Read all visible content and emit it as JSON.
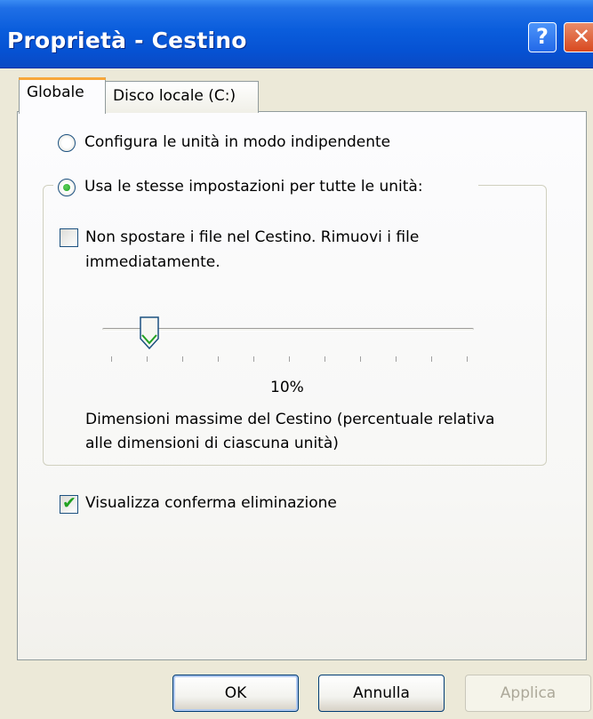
{
  "window": {
    "title": "Proprietà - Cestino",
    "help_label": "?",
    "close_label": "✕"
  },
  "tabs": [
    {
      "label": "Globale",
      "active": true
    },
    {
      "label": "Disco locale (C:)",
      "active": false
    }
  ],
  "options": {
    "radio_independent": {
      "label": "Configura le unità in modo indipendente",
      "checked": false
    },
    "radio_same": {
      "label": "Usa le stesse impostazioni per tutte le unità:",
      "checked": true
    },
    "no_recycle": {
      "line1": "Non spostare i file nel Cestino. Rimuovi i file",
      "line2": "immediatamente.",
      "checked": false
    },
    "slider": {
      "value_label": "10%",
      "value_percent": 10,
      "tick_count": 11
    },
    "size_desc": {
      "line1": "Dimensioni massime del Cestino (percentuale relativa",
      "line2": "alle dimensioni di ciascuna unità)"
    },
    "confirm_delete": {
      "label": "Visualizza conferma eliminazione",
      "checked": true
    }
  },
  "buttons": {
    "ok": "OK",
    "cancel": "Annulla",
    "apply": "Applica"
  },
  "colors": {
    "titlebar": "#0a5ddc",
    "active_tab_accent": "#f7a73a",
    "check_green": "#21a121",
    "window_bg": "#ECE9D8"
  }
}
